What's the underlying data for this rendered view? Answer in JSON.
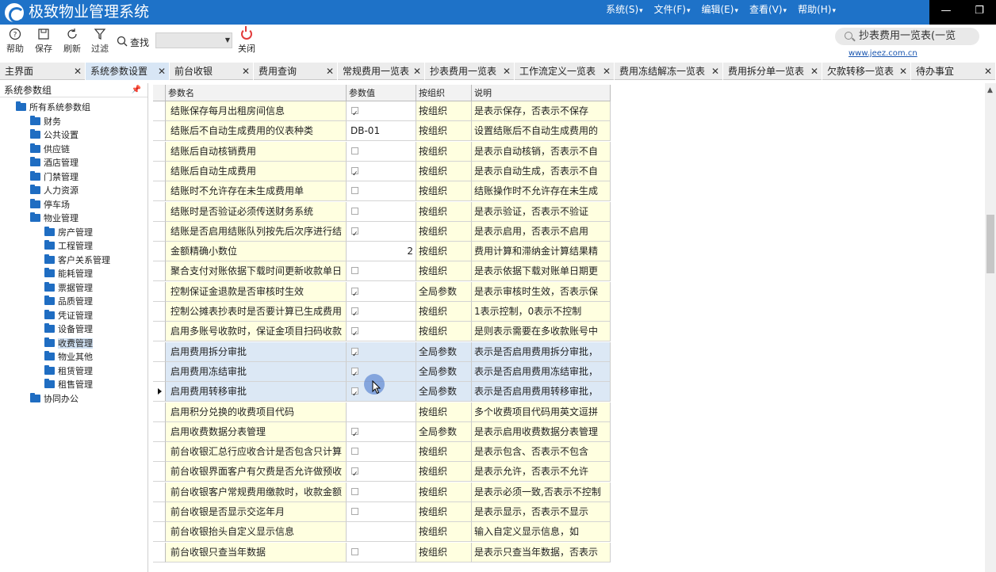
{
  "app": {
    "title": "极致物业管理系统",
    "menus": [
      "系统(S)",
      "文件(F)",
      "编辑(E)",
      "查看(V)",
      "帮助(H)"
    ]
  },
  "toolbar": {
    "help": "帮助",
    "save": "保存",
    "refresh": "刷新",
    "filter": "过滤",
    "search_label": "查找",
    "search_value": "",
    "close": "关闭",
    "global_search": "抄表费用一览表(一览",
    "website": "www.jeez.com.cn"
  },
  "tabs": [
    {
      "label": "主界面"
    },
    {
      "label": "系统参数设置",
      "active": true
    },
    {
      "label": "前台收银"
    },
    {
      "label": "费用查询"
    },
    {
      "label": "常规费用一览表"
    },
    {
      "label": "抄表费用一览表"
    },
    {
      "label": "工作流定义一览表"
    },
    {
      "label": "费用冻结解冻一览表"
    },
    {
      "label": "费用拆分单一览表"
    },
    {
      "label": "欠款转移一览表"
    },
    {
      "label": "待办事宜"
    }
  ],
  "left_panel": {
    "title": "系统参数组",
    "pin": "ᵖ",
    "tree": [
      {
        "label": "所有系统参数组",
        "level": 0
      },
      {
        "label": "财务",
        "level": 1
      },
      {
        "label": "公共设置",
        "level": 1
      },
      {
        "label": "供应链",
        "level": 1
      },
      {
        "label": "酒店管理",
        "level": 1
      },
      {
        "label": "门禁管理",
        "level": 1
      },
      {
        "label": "人力资源",
        "level": 1
      },
      {
        "label": "停车场",
        "level": 1
      },
      {
        "label": "物业管理",
        "level": 1
      },
      {
        "label": "房产管理",
        "level": 2
      },
      {
        "label": "工程管理",
        "level": 2
      },
      {
        "label": "客户关系管理",
        "level": 2
      },
      {
        "label": "能耗管理",
        "level": 2
      },
      {
        "label": "票据管理",
        "level": 2
      },
      {
        "label": "品质管理",
        "level": 2
      },
      {
        "label": "凭证管理",
        "level": 2
      },
      {
        "label": "设备管理",
        "level": 2
      },
      {
        "label": "收费管理",
        "level": 2,
        "selected": true
      },
      {
        "label": "物业其他",
        "level": 2
      },
      {
        "label": "租赁管理",
        "level": 2
      },
      {
        "label": "租售管理",
        "level": 2
      },
      {
        "label": "协同办公",
        "level": 1
      }
    ]
  },
  "grid": {
    "columns": [
      "参数名",
      "参数值",
      "按组织",
      "说明"
    ],
    "rows": [
      {
        "name": "结账保存每月出租房间信息",
        "type": "check",
        "checked": true,
        "scope": "按组织",
        "desc": "是表示保存，否表示不保存"
      },
      {
        "name": "结账后不自动生成费用的仪表种类",
        "type": "text",
        "value": "DB-01",
        "scope": "按组织",
        "desc": "设置结账后不自动生成费用的"
      },
      {
        "name": "结账后自动核销费用",
        "type": "check",
        "checked": false,
        "scope": "按组织",
        "desc": "是表示自动核销，否表示不自"
      },
      {
        "name": "结账后自动生成费用",
        "type": "check",
        "checked": true,
        "scope": "按组织",
        "desc": "是表示自动生成，否表示不自"
      },
      {
        "name": "结账时不允许存在未生成费用单",
        "type": "check",
        "checked": false,
        "scope": "按组织",
        "desc": "结账操作时不允许存在未生成"
      },
      {
        "name": "结账时是否验证必须传送财务系统",
        "type": "check",
        "checked": false,
        "scope": "按组织",
        "desc": "是表示验证，否表示不验证"
      },
      {
        "name": "结账是否启用结账队列按先后次序进行结",
        "type": "check",
        "checked": true,
        "scope": "按组织",
        "desc": "是表示启用，否表示不启用"
      },
      {
        "name": "金额精确小数位",
        "type": "number",
        "value": "2",
        "scope": "按组织",
        "desc": "费用计算和滞纳金计算结果精"
      },
      {
        "name": "聚合支付对账依据下载时间更新收款单日",
        "type": "check",
        "checked": false,
        "scope": "按组织",
        "desc": "是表示依据下载对账单日期更"
      },
      {
        "name": "控制保证金退款是否审核时生效",
        "type": "check",
        "checked": true,
        "scope": "全局参数",
        "desc": "是表示审核时生效，否表示保"
      },
      {
        "name": "控制公摊表抄表时是否要计算已生成费用",
        "type": "check",
        "checked": true,
        "scope": "按组织",
        "desc": "1表示控制，0表示不控制"
      },
      {
        "name": "启用多账号收款时，保证金项目扫码收款",
        "type": "check",
        "checked": true,
        "scope": "按组织",
        "desc": "是则表示需要在多收款账号中"
      },
      {
        "name": "启用费用拆分审批",
        "type": "check",
        "checked": true,
        "scope": "全局参数",
        "desc": "表示是否启用费用拆分审批，",
        "highlight": true
      },
      {
        "name": "启用费用冻结审批",
        "type": "check",
        "checked": true,
        "scope": "全局参数",
        "desc": "表示是否启用费用冻结审批，",
        "highlight": true
      },
      {
        "name": "启用费用转移审批",
        "type": "check",
        "checked": true,
        "scope": "全局参数",
        "desc": "表示是否启用费用转移审批，",
        "highlight": true,
        "current": true
      },
      {
        "name": "启用积分兑换的收费项目代码",
        "type": "text",
        "value": "",
        "scope": "按组织",
        "desc": "多个收费项目代码用英文逗拼"
      },
      {
        "name": "启用收费数据分表管理",
        "type": "check",
        "checked": true,
        "scope": "全局参数",
        "desc": "是表示启用收费数据分表管理"
      },
      {
        "name": "前台收银汇总行应收合计是否包含只计算",
        "type": "check",
        "checked": false,
        "scope": "按组织",
        "desc": "是表示包含、否表示不包含"
      },
      {
        "name": "前台收银界面客户有欠费是否允许做预收",
        "type": "check",
        "checked": true,
        "scope": "按组织",
        "desc": "是表示允许，否表示不允许"
      },
      {
        "name": "前台收银客户常规费用缴款时，收款金额",
        "type": "check",
        "checked": false,
        "scope": "按组织",
        "desc": "是表示必须一致,否表示不控制"
      },
      {
        "name": "前台收银是否显示交迄年月",
        "type": "check",
        "checked": false,
        "scope": "按组织",
        "desc": "是表示显示，否表示不显示"
      },
      {
        "name": "前台收银抬头自定义显示信息",
        "type": "text",
        "value": "",
        "scope": "按组织",
        "desc": "输入自定义显示信息，如"
      },
      {
        "name": "前台收银只查当年数据",
        "type": "check",
        "checked": false,
        "scope": "按组织",
        "desc": "是表示只查当年数据，否表示"
      }
    ]
  }
}
